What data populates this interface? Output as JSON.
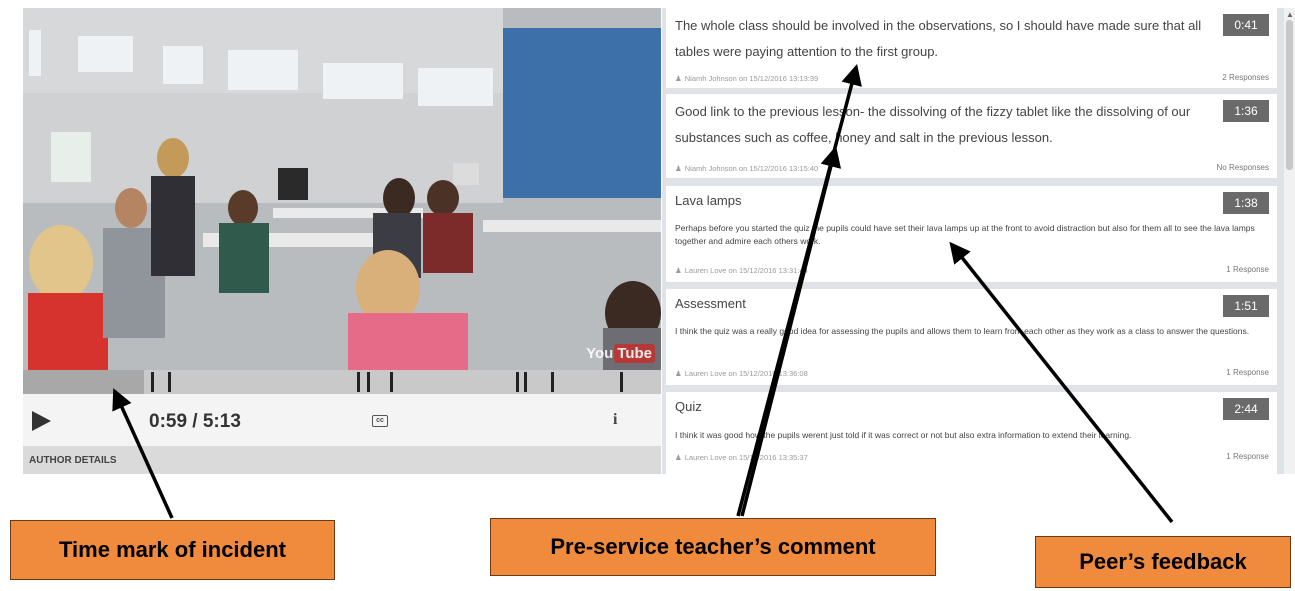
{
  "video": {
    "watermark_you": "You",
    "watermark_tube": "Tube",
    "played_fraction": 0.19,
    "incident_marker_times": [
      "1:03",
      "1:11",
      "2:44",
      "2:49",
      "3:00",
      "4:02",
      "4:06",
      "4:19",
      "4:53"
    ],
    "time_display": "0:59 / 5:13",
    "cc_label": "cc",
    "info_label": "i",
    "author_bar_label": "AUTHOR DETAILS"
  },
  "comments": [
    {
      "text": "The whole class should be involved in the observations, so I should have made sure that all tables were paying attention to the first group.",
      "time": "0:41",
      "meta": "Niamh Johnson on 15/12/2016 13:13:39",
      "responses": "2 Responses"
    },
    {
      "text": "Good link to the previous lesson- the dissolving of the fizzy tablet like the dissolving of our substances such as coffee, honey and salt in the previous lesson.",
      "time": "1:36",
      "meta": "Niamh Johnson on 15/12/2016 13:15:40",
      "responses": "No Responses"
    },
    {
      "title": "Lava lamps",
      "text": "Perhaps before you started the quiz the pupils could have set their lava lamps up at the front to avoid distraction but also for them all to see the lava lamps together and admire each others work.",
      "time": "1:38",
      "meta": "Lauren Love on 15/12/2016 13:31:44",
      "responses": "1 Response"
    },
    {
      "title": "Assessment",
      "text": "I think the quiz was a really good idea for assessing the pupils and allows them to learn from each other as they work as a class to answer the questions.",
      "time": "1:51",
      "meta": "Lauren Love on 15/12/2016 13:36:08",
      "responses": "1 Response"
    },
    {
      "title": "Quiz",
      "text": "I think it was good how the pupils werent just told if it was correct or not but also extra information to extend their learning.",
      "time": "2:44",
      "meta": "Lauren Love on 15/12/2016 13:35:37",
      "responses": "1 Response"
    }
  ],
  "annotations": {
    "time_mark": "Time mark of incident",
    "teacher_comment": "Pre-service teacher’s comment",
    "peer_feedback": "Peer’s feedback"
  },
  "colors": {
    "callout_fill": "#f08a3c",
    "time_badge": "#6a6a6a",
    "panel_background": "#dfe2e6"
  }
}
